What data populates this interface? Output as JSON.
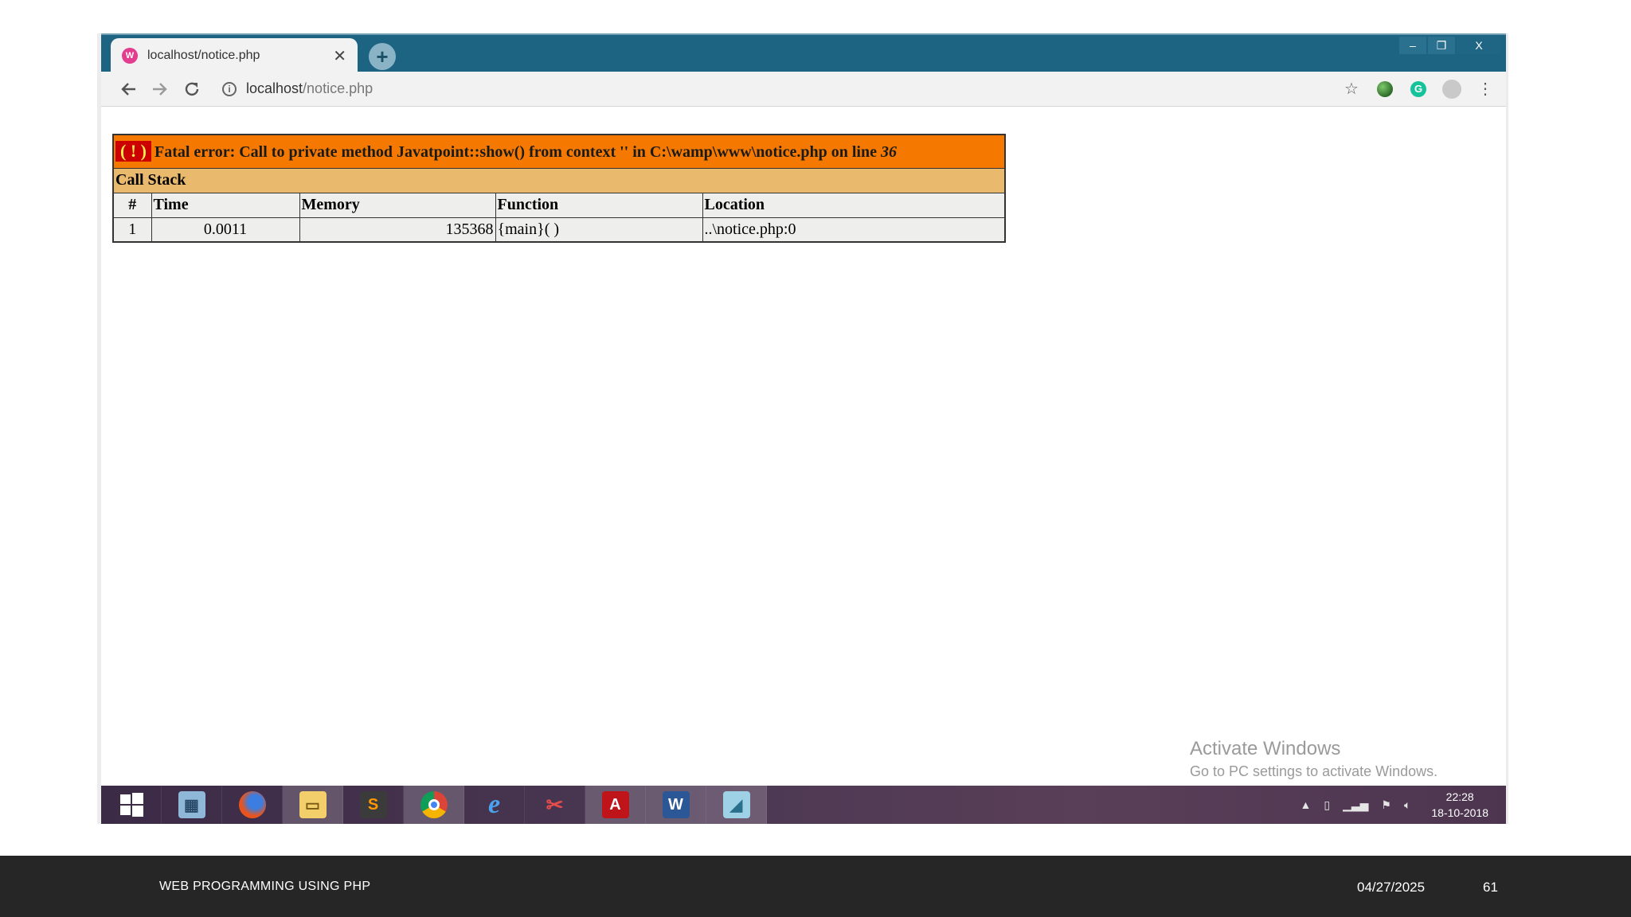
{
  "browser": {
    "tab_title": "localhost/notice.php",
    "tab_close": "✕",
    "new_tab": "+",
    "url_host": "localhost",
    "url_path": "/notice.php",
    "window_controls": [
      "–",
      "❐",
      "X"
    ],
    "toolbar_icons": [
      "star-icon",
      "extension-icon",
      "grammarly-icon",
      "profile-icon",
      "menu-icon"
    ]
  },
  "error": {
    "badge": "( ! )",
    "message": "Fatal error: Call to private method Javatpoint::show() from context '' in C:\\wamp\\www\\notice.php on line ",
    "line": "36",
    "call_stack_label": "Call Stack",
    "columns": [
      "#",
      "Time",
      "Memory",
      "Function",
      "Location"
    ],
    "rows": [
      {
        "num": "1",
        "time": "0.0011",
        "memory": "135368",
        "function": "{main}( )",
        "location": "..\\notice.php:0"
      }
    ]
  },
  "watermark": {
    "title": "Activate Windows",
    "subtitle": "Go to PC settings to activate Windows."
  },
  "taskbar": {
    "apps": [
      "start-icon",
      "calculator-icon",
      "firefox-icon",
      "file-explorer-icon",
      "sublime-text-icon",
      "chrome-icon",
      "internet-explorer-icon",
      "snipping-tool-icon",
      "acrobat-icon",
      "word-icon",
      "notepad-icon"
    ],
    "active_app": "chrome-icon",
    "clock_time": "22:28",
    "clock_date": "18-10-2018"
  },
  "footer": {
    "title": "WEB PROGRAMMING USING PHP",
    "date": "04/27/2025",
    "page": "61"
  },
  "colors": {
    "titlebar": "#1c6482",
    "error_header": "#f57900",
    "call_stack_header": "#e9b96e",
    "table_cells": "#eeeeec",
    "error_badge": "#cc0000",
    "footer_bg": "#262626"
  }
}
